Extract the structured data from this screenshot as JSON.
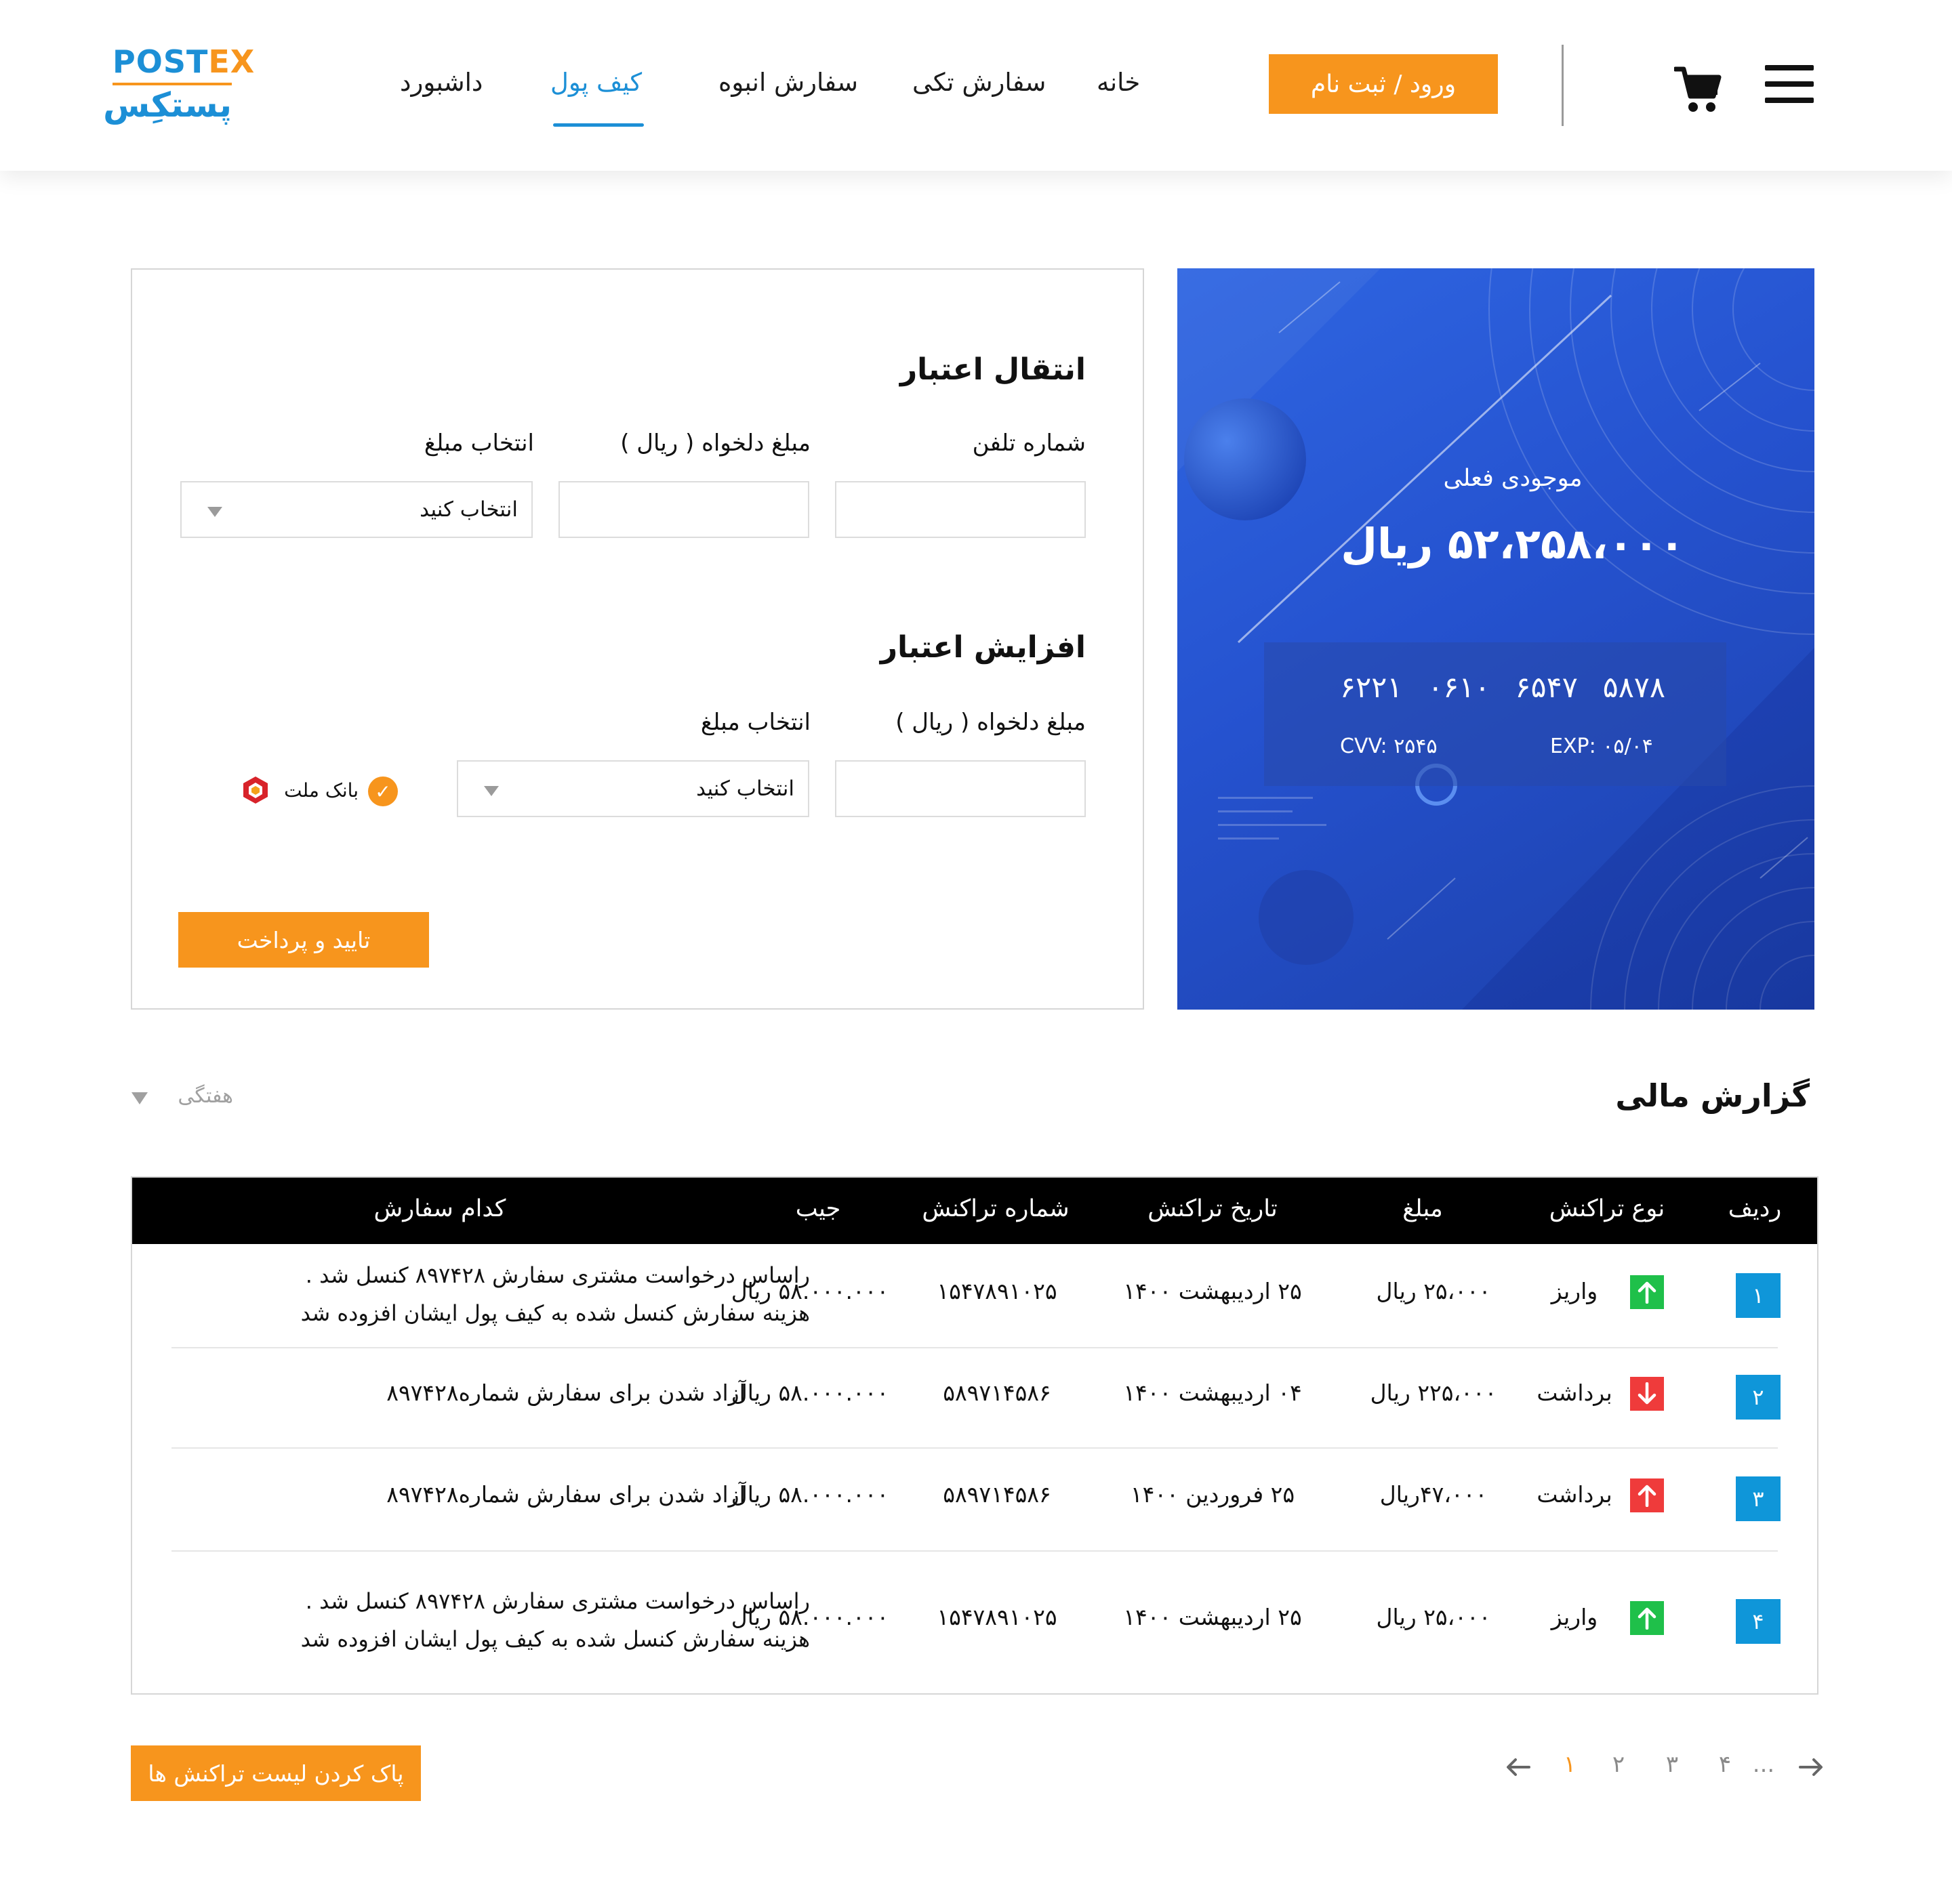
{
  "brand": {
    "logo_en_prefix": "POST",
    "logo_en_x": "EX",
    "logo_fa": "پستکِس",
    "accent": "#f7951d",
    "primary": "#1c8fd6"
  },
  "nav": {
    "items": [
      {
        "label": "داشبورد",
        "active": false
      },
      {
        "label": "کیف پول",
        "active": true
      },
      {
        "label": "سفارش انبوه",
        "active": false
      },
      {
        "label": "سفارش تکی",
        "active": false
      },
      {
        "label": "خانه",
        "active": false
      }
    ],
    "login_label": "ورود / ثبت نام",
    "cart_icon": "cart-icon",
    "menu_icon": "hamburger-menu-icon"
  },
  "transfer": {
    "title": "انتقال اعتبار",
    "phone_label": "شماره تلفن",
    "amount_label": "مبلغ دلخواه ( ریال )",
    "select_label": "انتخاب مبلغ",
    "select_value": "انتخاب کنید",
    "phone_value": "",
    "amount_value": ""
  },
  "topup": {
    "title": "افزایش اعتبار",
    "amount_label": "مبلغ دلخواه ( ریال )",
    "select_label": "انتخاب مبلغ",
    "select_value": "انتخاب کنید",
    "amount_value": "",
    "bank_name": "بانک ملت",
    "pay_label": "تایید و پرداخت"
  },
  "wallet_card": {
    "balance_label": "موجودی فعلی",
    "balance_value": "۵۲،۲۵۸،۰۰۰ ریال",
    "card_number": [
      "۶۲۲۱",
      "۰۶۱۰",
      "۶۵۴۷",
      "۵۸۷۸"
    ],
    "cvv": "CVV: ۲۵۴۵",
    "exp": "EXP: ۰۵/۰۴"
  },
  "report": {
    "title": "گزارش مالی",
    "period": "هفتگی",
    "columns": [
      "ردیف",
      "نوع تراکنش",
      "مبلغ",
      "تاریخ تراکنش",
      "شماره تراکنش",
      "جیب",
      "کدام سفارش"
    ],
    "rows": [
      {
        "index": "۱",
        "type": "واریز",
        "direction": "up",
        "icon_color": "green",
        "amount": "۲۵،۰۰۰ ریال",
        "date": "۲۵ اردیبهشت ۱۴۰۰",
        "tx_no": "۱۵۴۷۸۹۱۰۲۵",
        "pocket": "۵۸.۰۰۰.۰۰۰ ریال",
        "order_line1": "راساس درخواست مشتری سفارش ۸۹۷۴۲۸ کنسل شد .",
        "order_line2": "هزینه سفارش کنسل شده به کیف پول ایشان افزوده شد"
      },
      {
        "index": "۲",
        "type": "برداشت",
        "direction": "down",
        "icon_color": "red",
        "amount": "۲۲۵،۰۰۰ ریال",
        "date": "۰۴ اردیبهشت ۱۴۰۰",
        "tx_no": "۵۸۹۷۱۴۵۸۶",
        "pocket": "۵۸.۰۰۰.۰۰۰ ریال",
        "order_line1": "آزاد شدن برای سفارش شماره۸۹۷۴۲۸",
        "order_line2": ""
      },
      {
        "index": "۳",
        "type": "برداشت",
        "direction": "up",
        "icon_color": "red",
        "amount": "۴۷،۰۰۰ریال",
        "date": "۲۵ فروردین ۱۴۰۰",
        "tx_no": "۵۸۹۷۱۴۵۸۶",
        "pocket": "۵۸.۰۰۰.۰۰۰ ریال",
        "order_line1": "آزاد شدن برای سفارش شماره۸۹۷۴۲۸",
        "order_line2": ""
      },
      {
        "index": "۴",
        "type": "واریز",
        "direction": "up",
        "icon_color": "green",
        "amount": "۲۵،۰۰۰ ریال",
        "date": "۲۵ اردیبهشت ۱۴۰۰",
        "tx_no": "۱۵۴۷۸۹۱۰۲۵",
        "pocket": "۵۸.۰۰۰.۰۰۰ ریال",
        "order_line1": "راساس درخواست مشتری سفارش ۸۹۷۴۲۸ کنسل شد .",
        "order_line2": "هزینه سفارش کنسل شده به کیف پول ایشان افزوده شد"
      }
    ]
  },
  "footer": {
    "clear_label": "پاک کردن لیست تراکنش ها",
    "pages": [
      "۱",
      "۲",
      "۳",
      "۴",
      "..."
    ],
    "current_page": "۱"
  }
}
